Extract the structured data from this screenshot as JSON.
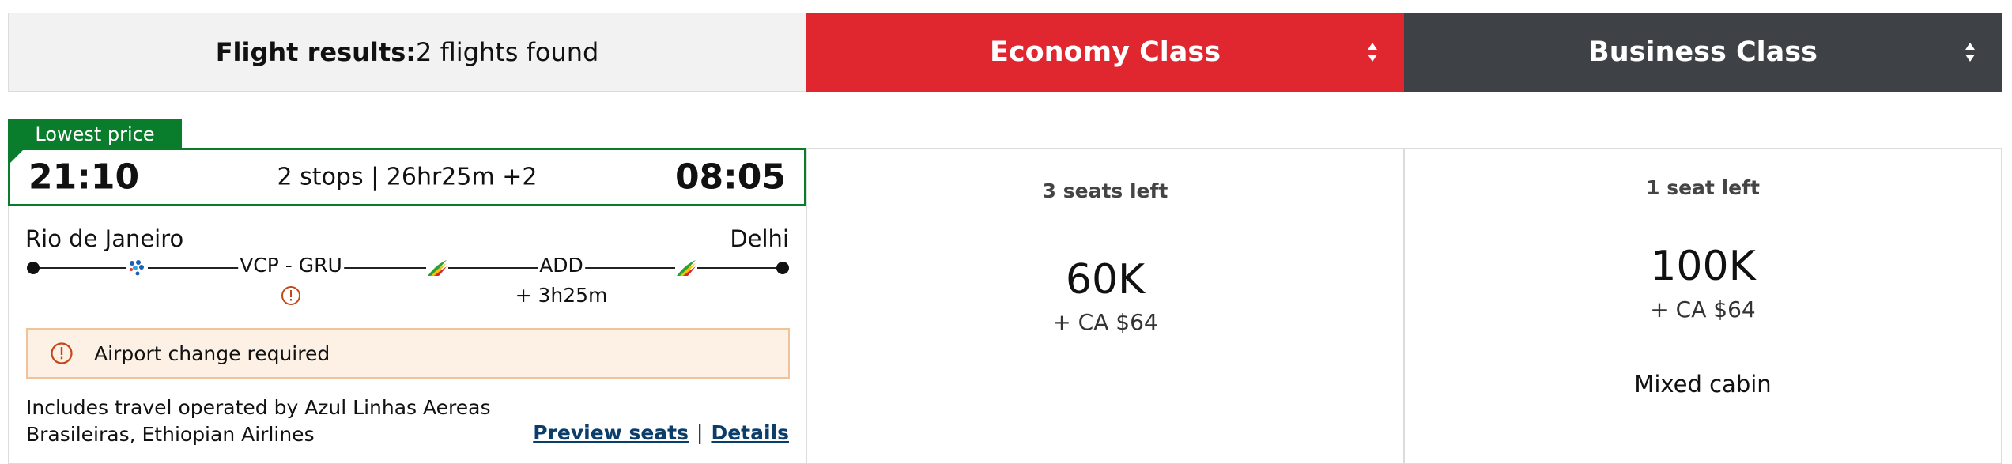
{
  "header": {
    "results_label": "Flight results:",
    "results_count": "2 flights found",
    "economy_label": "Economy Class",
    "business_label": "Business Class",
    "sort_icon": "sort-updown-icon"
  },
  "colors": {
    "economy": "#e0262f",
    "business": "#3e4246",
    "badge_green": "#0a7d2c",
    "alert_bg": "#fdf0e5",
    "alert_icon": "#c4471a",
    "link": "#0b3d6b"
  },
  "flight": {
    "badge": "Lowest price",
    "departure_time": "21:10",
    "arrival_time": "08:05",
    "summary": "2 stops | 26hr25m +2",
    "origin_city": "Rio de Janeiro",
    "destination_city": "Delhi",
    "connections": [
      {
        "label": "VCP - GRU",
        "airport_change": true,
        "warning_icon": "alert-circle-icon"
      },
      {
        "label": "ADD",
        "layover": "+ 3h25m"
      }
    ],
    "airline_icons": [
      "azul-logo-icon",
      "ethiopian-logo-icon",
      "ethiopian-logo-icon"
    ],
    "alert": "Airport change required",
    "operated_by": "Includes travel operated by Azul Linhas Aereas Brasileiras, Ethiopian Airlines",
    "preview_seats": "Preview seats",
    "divider": "|",
    "details": "Details"
  },
  "fares": {
    "economy": {
      "seats": "3 seats left",
      "points": "60K",
      "tax": "+ CA $64"
    },
    "business": {
      "seats": "1 seat left",
      "points": "100K",
      "tax": "+ CA $64",
      "note": "Mixed cabin"
    }
  }
}
